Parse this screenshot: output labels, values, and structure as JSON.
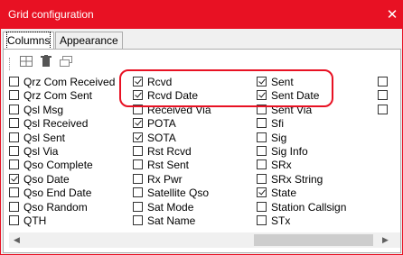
{
  "window": {
    "title": "Grid configuration",
    "close_glyph": "✕"
  },
  "tabs": [
    {
      "label": "Columns",
      "active": true
    },
    {
      "label": "Appearance",
      "active": false
    }
  ],
  "toolbar": {
    "icons": [
      "grid-layout-icon",
      "delete-icon",
      "window-icon"
    ]
  },
  "columns": [
    [
      {
        "label": "Qrz Com Received",
        "checked": false
      },
      {
        "label": "Qrz Com Sent",
        "checked": false
      },
      {
        "label": "Qsl Msg",
        "checked": false
      },
      {
        "label": "Qsl Received",
        "checked": false
      },
      {
        "label": "Qsl Sent",
        "checked": false
      },
      {
        "label": "Qsl Via",
        "checked": false
      },
      {
        "label": "Qso Complete",
        "checked": false
      },
      {
        "label": "Qso Date",
        "checked": true
      },
      {
        "label": "Qso End Date",
        "checked": false
      },
      {
        "label": "Qso Random",
        "checked": false
      },
      {
        "label": "QTH",
        "checked": false
      }
    ],
    [
      {
        "label": "Rcvd",
        "checked": true
      },
      {
        "label": "Rcvd Date",
        "checked": true
      },
      {
        "label": "Received Via",
        "checked": false
      },
      {
        "label": "POTA",
        "checked": true
      },
      {
        "label": "SOTA",
        "checked": true
      },
      {
        "label": "Rst Rcvd",
        "checked": false
      },
      {
        "label": "Rst Sent",
        "checked": false
      },
      {
        "label": "Rx Pwr",
        "checked": false
      },
      {
        "label": "Satellite Qso",
        "checked": false
      },
      {
        "label": "Sat Mode",
        "checked": false
      },
      {
        "label": "Sat Name",
        "checked": false
      }
    ],
    [
      {
        "label": "Sent",
        "checked": true
      },
      {
        "label": "Sent Date",
        "checked": true
      },
      {
        "label": "Sent Via",
        "checked": false
      },
      {
        "label": "Sfi",
        "checked": false
      },
      {
        "label": "Sig",
        "checked": false
      },
      {
        "label": "Sig Info",
        "checked": false
      },
      {
        "label": "SRx",
        "checked": false
      },
      {
        "label": "SRx String",
        "checked": false
      },
      {
        "label": "State",
        "checked": true
      },
      {
        "label": "Station Callsign",
        "checked": false
      },
      {
        "label": "STx",
        "checked": false
      }
    ],
    [
      {
        "label": "",
        "checked": false
      },
      {
        "label": "",
        "checked": false
      },
      {
        "label": "",
        "checked": false
      }
    ]
  ],
  "scrollbar": {
    "left_glyph": "◀",
    "right_glyph": "▶"
  },
  "colors": {
    "titlebar": "#e81123",
    "highlight": "#e81123"
  }
}
